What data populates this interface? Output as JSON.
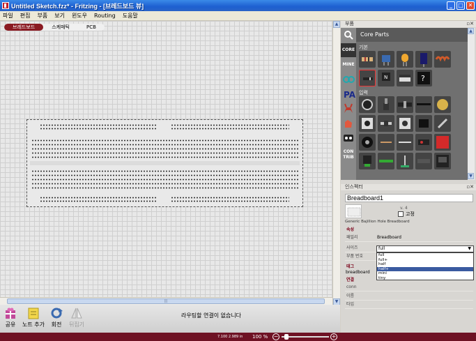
{
  "window": {
    "title": "Untitled Sketch.fzz* - Fritzing - [브레드보드 뷰]"
  },
  "menu": [
    "파일",
    "편집",
    "부품",
    "보기",
    "윈도우",
    "Routing",
    "도움말"
  ],
  "view_tabs": [
    "브레드보드",
    "스케매틱",
    "PCB"
  ],
  "toolbar": {
    "share": "공유",
    "add_note": "노트 추가",
    "rotate": "회전",
    "flip": "뒤집기",
    "status_message": "라우팅할 연결이 없습니다"
  },
  "statusbar": {
    "zoom": "100 %",
    "coordinates": "7.100 2.989 in"
  },
  "parts_panel": {
    "title": "부품",
    "header": "Core Parts",
    "nav": [
      "CORE",
      "MINE",
      "CON TRIB"
    ],
    "sections": [
      "기본",
      "입력"
    ]
  },
  "inspector": {
    "title": "인스펙터",
    "part_name": "Breadboard1",
    "version": "v. 4",
    "lock_label": "고정",
    "description": "Generic Bajillion Hole Breadboard",
    "properties_header": "속성",
    "family_label": "패밀리",
    "family_value": "Breadboard",
    "size_label": "사이즈",
    "size_value": "full",
    "size_options": [
      "full",
      "full+",
      "half",
      "half+",
      "mini",
      "tiny"
    ],
    "size_selected_index": 3,
    "part_number_label": "부품 번호",
    "tags_header": "태그",
    "tags_value": "breadboard",
    "connections_header": "연결",
    "conn_label": "conn",
    "name_label": "이름",
    "type_label": "타입"
  },
  "colors": {
    "accent": "#8a1a22",
    "titlebar": "#1d5fd0",
    "statusbar": "#6e1224"
  }
}
